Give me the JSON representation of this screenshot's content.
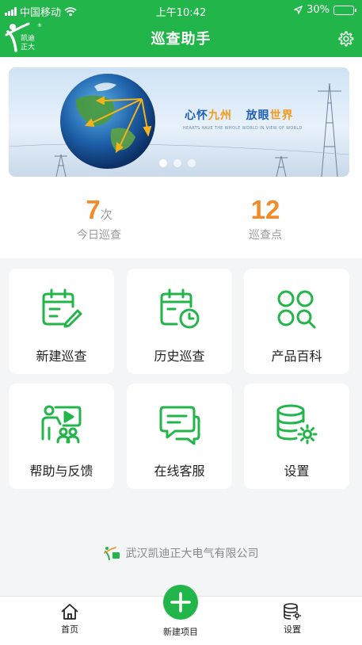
{
  "status_bar": {
    "carrier": "中国移动",
    "time": "上午10:42",
    "battery": "30%",
    "battery_level": 0.3
  },
  "header": {
    "title": "巡查助手",
    "logo_text_1": "凯迪",
    "logo_text_2": "正大"
  },
  "banner": {
    "headline_1": "心怀",
    "headline_2": "九州",
    "headline_3": "放眼",
    "headline_4": "世界",
    "subline": "HEARTS HAVE THE WHOLE WORLD IN VIEW OF WORLD",
    "slides": 3,
    "active_slide": 0
  },
  "stats": [
    {
      "value": "7",
      "unit": "次",
      "label": "今日巡查"
    },
    {
      "value": "12",
      "unit": "",
      "label": "巡查点"
    }
  ],
  "menu": [
    {
      "label": "新建巡查",
      "icon": "calendar-edit-icon"
    },
    {
      "label": "历史巡查",
      "icon": "calendar-clock-icon"
    },
    {
      "label": "产品百科",
      "icon": "grid-search-icon"
    },
    {
      "label": "帮助与反馈",
      "icon": "video-teaching-icon"
    },
    {
      "label": "在线客服",
      "icon": "chat-bubble-icon"
    },
    {
      "label": "设置",
      "icon": "database-gear-icon"
    }
  ],
  "footer": {
    "company": "武汉凯迪正大电气有限公司"
  },
  "tabbar": {
    "home": "首页",
    "new_project": "新建项目",
    "settings": "设置"
  },
  "colors": {
    "brand_green": "#22b54a",
    "accent_orange": "#f28c2a"
  }
}
